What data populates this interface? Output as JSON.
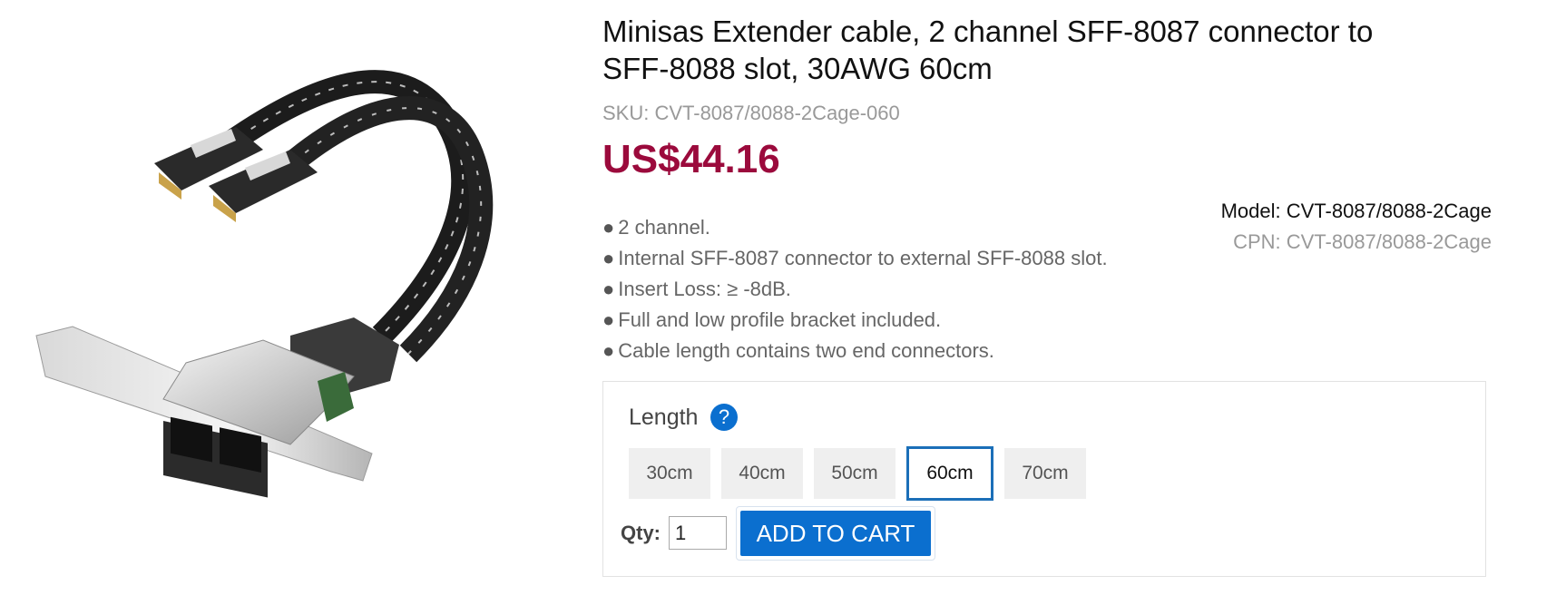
{
  "product": {
    "title": "Minisas Extender cable, 2 channel SFF-8087 connector to SFF-8088 slot, 30AWG 60cm",
    "sku": "SKU: CVT-8087/8088-2Cage-060",
    "price": "US$44.16",
    "price_color": "#9b0a3c",
    "features": [
      "2 channel.",
      "Internal SFF-8087 connector to external SFF-8088 slot.",
      "Insert Loss: ≥ -8dB.",
      "Full and low profile bracket included.",
      "Cable length contains two end connectors."
    ],
    "bullet": "●",
    "model": "Model: CVT-8087/8088-2Cage",
    "cpn": "CPN: CVT-8087/8088-2Cage"
  },
  "options": {
    "length_label": "Length",
    "help_icon": "?",
    "lengths": [
      "30cm",
      "40cm",
      "50cm",
      "60cm",
      "70cm"
    ],
    "selected_length": "60cm"
  },
  "cart": {
    "qty_label": "Qty:",
    "qty_value": "1",
    "add_to_cart_label": "ADD TO CART",
    "button_color": "#0b6fcf"
  }
}
